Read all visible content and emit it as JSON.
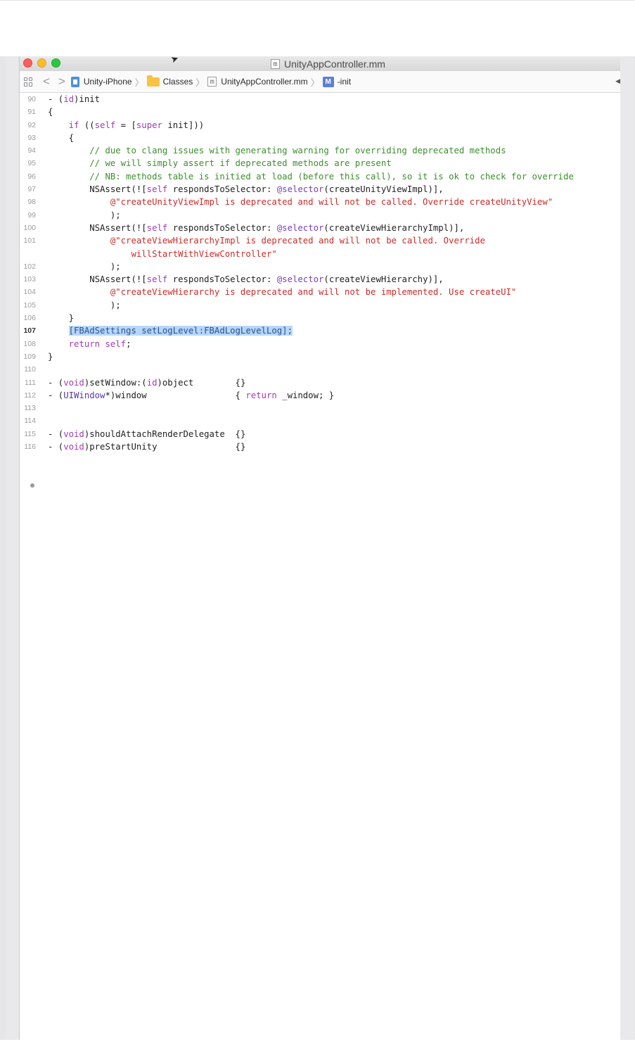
{
  "window": {
    "title": "UnityAppController.mm",
    "file_icon_letter": "m"
  },
  "jumpbar": {
    "back_glyph": "<",
    "forward_glyph": ">",
    "crumbs": [
      "Unity-iPhone",
      "Classes",
      "UnityAppController.mm",
      "-init"
    ],
    "method_icon_letter": "M"
  },
  "editor": {
    "lines": [
      {
        "num": "90",
        "text": "- (id)init"
      },
      {
        "num": "91",
        "text": "{"
      },
      {
        "num": "92",
        "text": "    if ((self = [super init]))"
      },
      {
        "num": "93",
        "text": "    {"
      },
      {
        "num": "94",
        "text": "        // due to clang issues with generating warning for overriding deprecated methods"
      },
      {
        "num": "95",
        "text": "        // we will simply assert if deprecated methods are present"
      },
      {
        "num": "96",
        "text": "        // NB: methods table is initied at load (before this call), so it is ok to check for override"
      },
      {
        "num": "97",
        "text": "        NSAssert(![self respondsToSelector: @selector(createUnityViewImpl)],"
      },
      {
        "num": "98",
        "text": "            @\"createUnityViewImpl is deprecated and will not be called. Override createUnityView\""
      },
      {
        "num": "99",
        "text": "            );"
      },
      {
        "num": "100",
        "text": "        NSAssert(![self respondsToSelector: @selector(createViewHierarchyImpl)],"
      },
      {
        "num": "101",
        "text": "            @\"createViewHierarchyImpl is deprecated and will not be called. Override"
      },
      {
        "num": "",
        "text": "                willStartWithViewController\""
      },
      {
        "num": "102",
        "text": "            );"
      },
      {
        "num": "103",
        "text": "        NSAssert(![self respondsToSelector: @selector(createViewHierarchy)],"
      },
      {
        "num": "104",
        "text": "            @\"createViewHierarchy is deprecated and will not be implemented. Use createUI\""
      },
      {
        "num": "105",
        "text": "            );"
      },
      {
        "num": "106",
        "text": "    }"
      },
      {
        "num": "107",
        "text": "    [FBAdSettings setLogLevel:FBAdLogLevelLog];",
        "current": true
      },
      {
        "num": "108",
        "text": "    return self;"
      },
      {
        "num": "109",
        "text": "}"
      },
      {
        "num": "110",
        "text": ""
      },
      {
        "num": "111",
        "text": "- (void)setWindow:(id)object        {}"
      },
      {
        "num": "112",
        "text": "- (UIWindow*)window                 { return _window; }"
      },
      {
        "num": "113",
        "text": ""
      },
      {
        "num": "114",
        "text": ""
      },
      {
        "num": "115",
        "text": "- (void)shouldAttachRenderDelegate  {}"
      },
      {
        "num": "116",
        "text": "- (void)preStartUnity               {}"
      }
    ]
  },
  "colors": {
    "comment": "#3b8f2b",
    "keyword": "#a03cb4",
    "string": "#c92b28",
    "selection": "#b6d7fb"
  }
}
